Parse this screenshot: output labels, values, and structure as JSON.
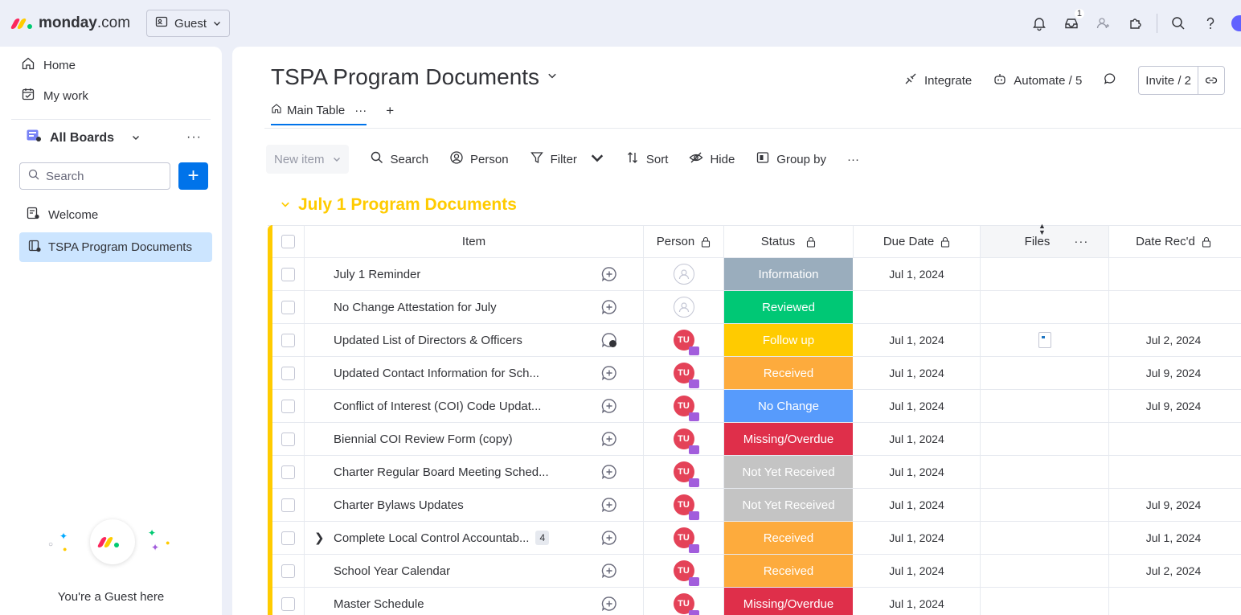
{
  "topbar": {
    "brand_bold": "monday",
    "brand_rest": ".com",
    "guest_label": "Guest",
    "inbox_badge": "1"
  },
  "sidebar": {
    "home": "Home",
    "my_work": "My work",
    "all_boards": "All Boards",
    "more": "···",
    "search_placeholder": "Search",
    "welcome": "Welcome",
    "board": "TSPA Program Documents",
    "guest_text": "You're a Guest here"
  },
  "board": {
    "title": "TSPA Program Documents",
    "integrate": "Integrate",
    "automate": "Automate / 5",
    "invite": "Invite / 2",
    "tab_main": "Main Table",
    "tab_more": "···",
    "tab_add": "+"
  },
  "toolbar": {
    "new_item": "New item",
    "search": "Search",
    "person": "Person",
    "filter": "Filter",
    "sort": "Sort",
    "hide": "Hide",
    "group_by": "Group by",
    "more": "···"
  },
  "group": {
    "title": "July 1 Program Documents",
    "color": "#ffcb00"
  },
  "columns": {
    "item": "Item",
    "person": "Person",
    "status": "Status",
    "due": "Due Date",
    "files": "Files",
    "files_more": "···",
    "received": "Date Rec'd"
  },
  "status_colors": {
    "Information": "#9aadbd",
    "Reviewed": "#00c875",
    "Follow up": "#ffcb00",
    "Received": "#fdab3d",
    "No Change": "#579bfc",
    "Missing/Overdue": "#df2f4a",
    "Not Yet Received": "#c4c4c4"
  },
  "rows": [
    {
      "item": "July 1 Reminder",
      "person": "",
      "status": "Information",
      "due": "Jul 1, 2024",
      "file": false,
      "received": "",
      "update_count": "",
      "sub": ""
    },
    {
      "item": "No Change Attestation for July",
      "person": "",
      "status": "Reviewed",
      "due": "",
      "file": false,
      "received": "",
      "update_count": "",
      "sub": ""
    },
    {
      "item": "Updated List of Directors & Officers",
      "person": "TU",
      "status": "Follow up",
      "due": "Jul 1, 2024",
      "file": true,
      "received": "Jul 2, 2024",
      "update_count": "1",
      "sub": ""
    },
    {
      "item": "Updated Contact Information for Sch...",
      "person": "TU",
      "status": "Received",
      "due": "Jul 1, 2024",
      "file": false,
      "received": "Jul 9, 2024",
      "update_count": "",
      "sub": ""
    },
    {
      "item": "Conflict of Interest (COI) Code Updat...",
      "person": "TU",
      "status": "No Change",
      "due": "Jul 1, 2024",
      "file": false,
      "received": "Jul 9, 2024",
      "update_count": "",
      "sub": ""
    },
    {
      "item": "Biennial COI Review Form (copy)",
      "person": "TU",
      "status": "Missing/Overdue",
      "due": "Jul 1, 2024",
      "file": false,
      "received": "",
      "update_count": "",
      "sub": ""
    },
    {
      "item": "Charter Regular Board Meeting Sched...",
      "person": "TU",
      "status": "Not Yet Received",
      "due": "Jul 1, 2024",
      "file": false,
      "received": "",
      "update_count": "",
      "sub": ""
    },
    {
      "item": "Charter Bylaws Updates",
      "person": "TU",
      "status": "Not Yet Received",
      "due": "Jul 1, 2024",
      "file": false,
      "received": "Jul 9, 2024",
      "update_count": "",
      "sub": ""
    },
    {
      "item": "Complete Local Control Accountab...",
      "person": "TU",
      "status": "Received",
      "due": "Jul 1, 2024",
      "file": false,
      "received": "Jul 1, 2024",
      "update_count": "",
      "sub": "4"
    },
    {
      "item": "School Year Calendar",
      "person": "TU",
      "status": "Received",
      "due": "Jul 1, 2024",
      "file": false,
      "received": "Jul 2, 2024",
      "update_count": "",
      "sub": ""
    },
    {
      "item": "Master Schedule",
      "person": "TU",
      "status": "Missing/Overdue",
      "due": "Jul 1, 2024",
      "file": false,
      "received": "",
      "update_count": "",
      "sub": ""
    }
  ]
}
